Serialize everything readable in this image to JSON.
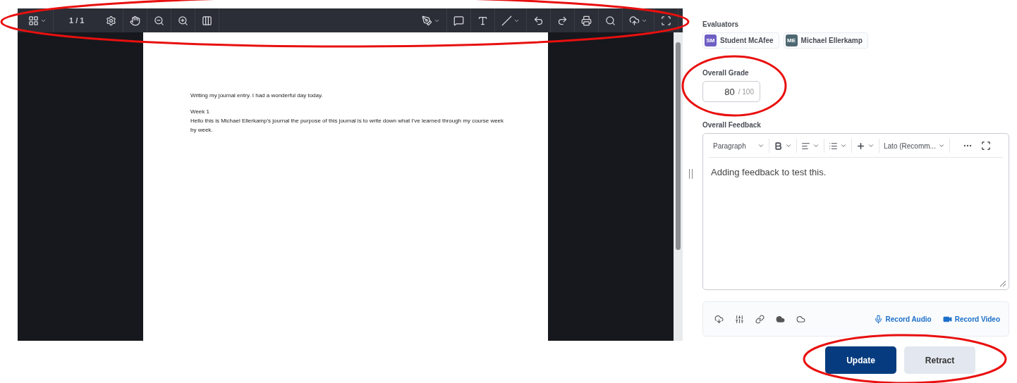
{
  "viewer": {
    "toolbar": {
      "page_indicator": "1 / 1"
    },
    "document": {
      "paragraphs": [
        "Writing my journal entry. I had a wonderful day today.",
        "Week 1\nHello this is Michael Ellerkamp’s journal the purpose of this journal is to write down what I’ve learned through my course week by week."
      ]
    }
  },
  "evaluators": {
    "label": "Evaluators",
    "items": [
      {
        "initials": "SM",
        "name": "Student McAfee",
        "color": "#6f5fc4"
      },
      {
        "initials": "ME",
        "name": "Michael Ellerkamp",
        "color": "#4e6872"
      }
    ]
  },
  "overall_grade": {
    "label": "Overall Grade",
    "value": "80",
    "out_of": "/ 100"
  },
  "overall_feedback": {
    "label": "Overall Feedback",
    "block_format": "Paragraph",
    "font": "Lato (Recomm...",
    "value": "Adding feedback to test this."
  },
  "attachments": {
    "links": [
      "Record Audio",
      "Record Video"
    ]
  },
  "buttons": [
    {
      "label": "Update",
      "kind": "primary"
    },
    {
      "label": "Retract",
      "kind": "secondary"
    }
  ],
  "annotations": [
    {
      "kind": "ellipse"
    },
    {
      "kind": "ellipse"
    },
    {
      "kind": "ellipse"
    }
  ]
}
